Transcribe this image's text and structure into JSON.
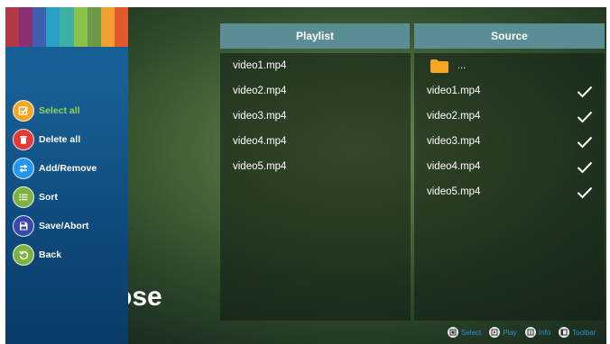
{
  "background_title": "ose",
  "sidebar": {
    "stripe_colors": [
      "#b33a44",
      "#8b2f72",
      "#3f5fb0",
      "#2aa0c6",
      "#3fb0a6",
      "#8bc34a",
      "#6a9a48",
      "#f0a030",
      "#e25a2c"
    ],
    "items": [
      {
        "label": "Select all",
        "icon": "select-all-icon",
        "color": "#f5a623",
        "active": true
      },
      {
        "label": "Delete all",
        "icon": "delete-icon",
        "color": "#e53935",
        "active": false
      },
      {
        "label": "Add/Remove",
        "icon": "add-remove-icon",
        "color": "#2196f3",
        "active": false
      },
      {
        "label": "Sort",
        "icon": "sort-icon",
        "color": "#7cb342",
        "active": false
      },
      {
        "label": "Save/Abort",
        "icon": "save-icon",
        "color": "#3949ab",
        "active": false
      },
      {
        "label": "Back",
        "icon": "back-icon",
        "color": "#7cb342",
        "active": false
      }
    ]
  },
  "playlist": {
    "header": "Playlist",
    "items": [
      "video1.mp4",
      "video2.mp4",
      "video3.mp4",
      "video4.mp4",
      "video5.mp4"
    ]
  },
  "source": {
    "header": "Source",
    "parent_label": "...",
    "items": [
      {
        "label": "video1.mp4",
        "checked": true
      },
      {
        "label": "video2.mp4",
        "checked": true
      },
      {
        "label": "video3.mp4",
        "checked": true
      },
      {
        "label": "video4.mp4",
        "checked": true
      },
      {
        "label": "video5.mp4",
        "checked": true
      }
    ]
  },
  "hints": [
    {
      "label": "Select",
      "icon": "select-key-icon"
    },
    {
      "label": "Play",
      "icon": "play-key-icon"
    },
    {
      "label": "Info",
      "icon": "info-key-icon"
    },
    {
      "label": "Toolbar",
      "icon": "toolbar-key-icon"
    }
  ],
  "colors": {
    "header_bg": "#5b8d94",
    "active_label": "#8fd35a",
    "folder": "#f5a623",
    "hint_text": "#2f8fd1"
  }
}
